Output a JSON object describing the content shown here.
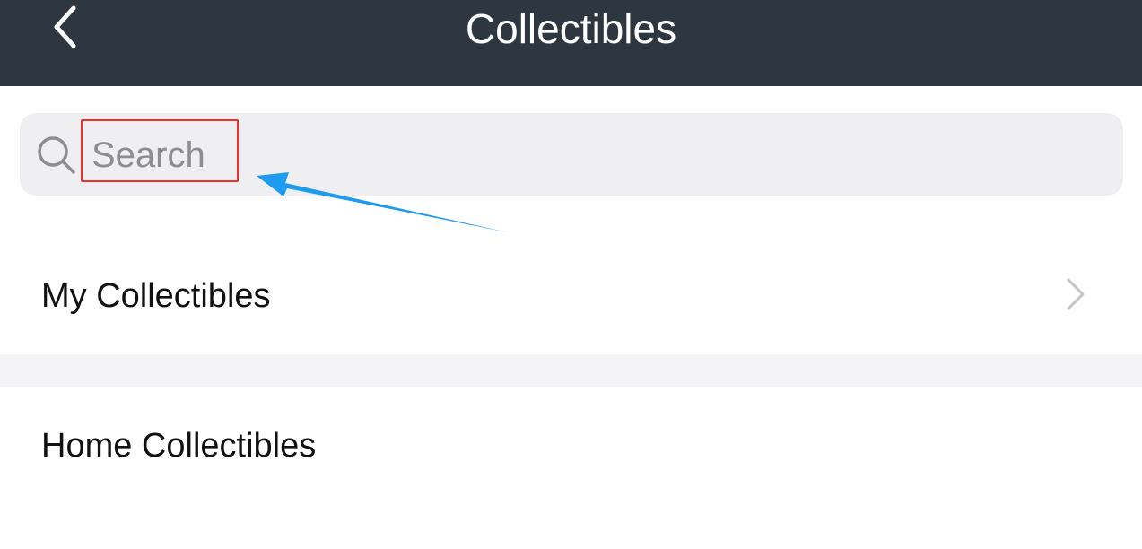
{
  "nav": {
    "title": "Collectibles",
    "back_icon": "chevron-left-icon",
    "background": "#2e3640"
  },
  "search": {
    "placeholder": "Search",
    "value": "",
    "icon": "search-icon",
    "background": "#efeff2"
  },
  "list": {
    "items": [
      {
        "label": "My Collectibles",
        "icon": "chevron-right-icon"
      },
      {
        "label": "Home Collectibles"
      }
    ]
  },
  "annotation": {
    "highlight_color": "#e8322b",
    "arrow_color": "#1e9bf0"
  }
}
